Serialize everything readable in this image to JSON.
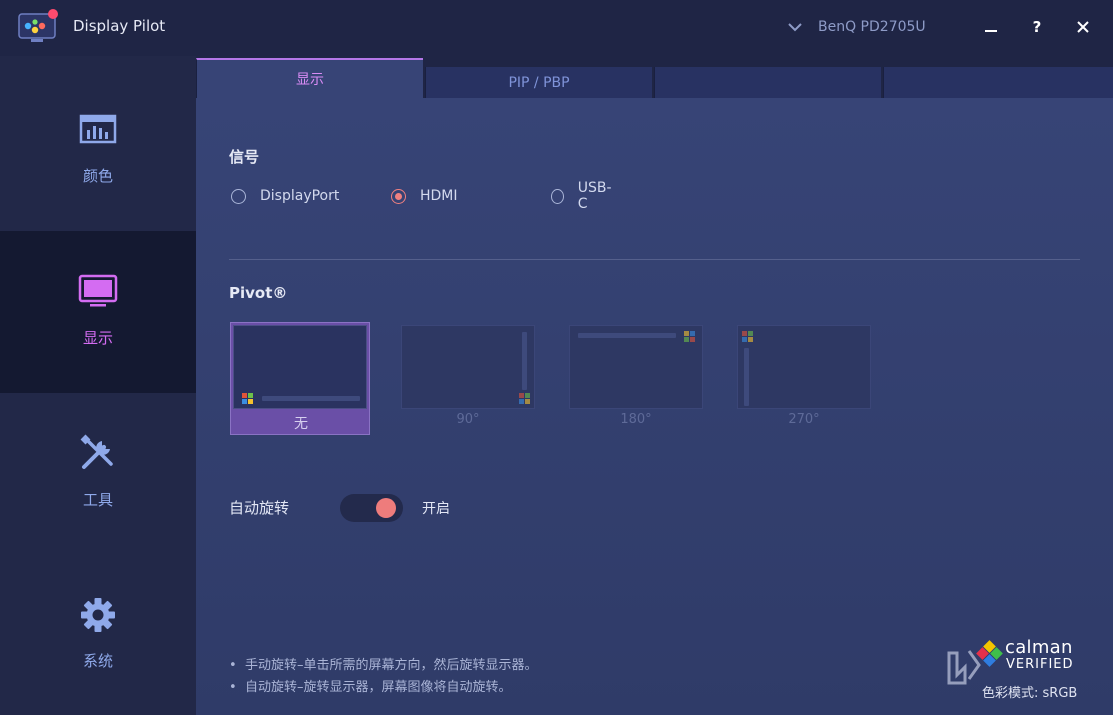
{
  "window": {
    "title": "Display Pilot",
    "monitor": "BenQ PD2705U",
    "help_label": "?"
  },
  "sidebar": {
    "items": [
      {
        "label": "颜色",
        "icon": "color-bars-icon",
        "active": false
      },
      {
        "label": "显示",
        "icon": "monitor-icon",
        "active": true
      },
      {
        "label": "工具",
        "icon": "tools-icon",
        "active": false
      },
      {
        "label": "系统",
        "icon": "gear-icon",
        "active": false
      }
    ]
  },
  "tabs": [
    {
      "label": "显示",
      "active": true
    },
    {
      "label": "PIP / PBP",
      "active": false
    },
    {
      "label": "",
      "active": false
    },
    {
      "label": "",
      "active": false
    }
  ],
  "signal": {
    "title": "信号",
    "options": [
      {
        "label": "DisplayPort",
        "checked": false
      },
      {
        "label": "HDMI",
        "checked": true
      },
      {
        "label": "USB-C",
        "checked": false
      }
    ]
  },
  "pivot": {
    "title": "Pivot®",
    "options": [
      {
        "label": "无",
        "selected": true
      },
      {
        "label": "90°",
        "selected": false
      },
      {
        "label": "180°",
        "selected": false
      },
      {
        "label": "270°",
        "selected": false
      }
    ]
  },
  "auto_rotate": {
    "label": "自动旋转",
    "state": "开启",
    "on": true
  },
  "notes": [
    "手动旋转–单击所需的屏幕方向，然后旋转显示器。",
    "自动旋转–旋转显示器，屏幕图像将自动旋转。"
  ],
  "calman": {
    "name": "calman",
    "verified": "VERIFIED",
    "color_mode": "色彩模式: sRGB"
  },
  "colors": {
    "accent_purple": "#d46cf2",
    "radio_selected": "#f08080",
    "toggle_knob": "#ee7c7c",
    "nav_blue": "#8fa9ea"
  }
}
